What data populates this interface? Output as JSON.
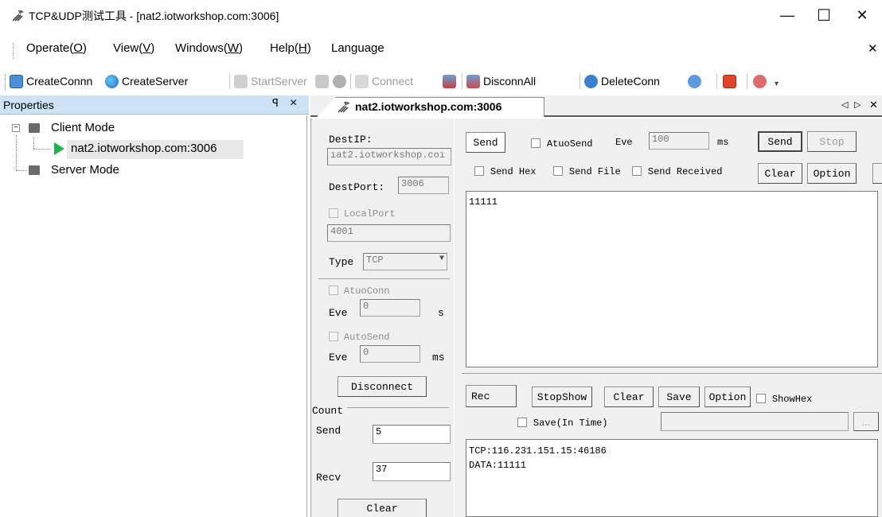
{
  "window": {
    "title": "TCP&UDP测试工具 - [nat2.iotworkshop.com:3006]",
    "minimize": "—",
    "maximize": "☐",
    "close": "✕",
    "menu_close": "✕"
  },
  "menu": {
    "items": [
      {
        "pre": "Operate(",
        "key": "O",
        "post": ")"
      },
      {
        "pre": "View(",
        "key": "V",
        "post": ")"
      },
      {
        "pre": "Windows(",
        "key": "W",
        "post": ")"
      },
      {
        "pre": "Help(",
        "key": "H",
        "post": ")"
      },
      {
        "pre": "Language",
        "key": "",
        "post": ""
      }
    ]
  },
  "toolbar": {
    "create_conn": "CreateConnn",
    "create_server": "CreateServer",
    "start_server": "StartServer",
    "connect": "Connect",
    "disconn_all": "DisconnAll",
    "delete_conn": "DeleteConn",
    "overflow": "▾"
  },
  "properties": {
    "title": "Properties",
    "pin": "ꟼ",
    "close": "×",
    "tree": {
      "client_mode": "Client Mode",
      "connection": "nat2.iotworkshop.com:3006",
      "server_mode": "Server Mode",
      "collapse": "−"
    }
  },
  "document": {
    "tab_label": "nat2.iotworkshop.com:3006",
    "nav_left": "◁",
    "nav_right": "▷",
    "close": "✕"
  },
  "settings": {
    "dest_ip_label": "DestIP:",
    "dest_ip_value": "ıat2.iotworkshop.coı",
    "dest_port_label": "DestPort:",
    "dest_port_value": "3006",
    "local_port_label": "LocalPort",
    "local_port_value": "4001",
    "type_label": "Type",
    "type_value": "TCP",
    "auto_conn_label": "AtuoConn",
    "eve_label_1": "Eve",
    "eve_value_1": "0",
    "eve_unit_1": "s",
    "auto_send_label": "AutoSend",
    "eve_label_2": "Eve",
    "eve_value_2": "0",
    "eve_unit_2": "ms",
    "disconnect_button": "Disconnect",
    "count_label": "Count",
    "send_label": "Send",
    "send_count": "5",
    "recv_label": "Recv",
    "recv_count": "37",
    "clear_button": "Clear"
  },
  "send_panel": {
    "send_tab": "Send",
    "auto_send_label": "AtuoSend",
    "eve_label": "Eve",
    "eve_value": "100",
    "ms_label": "ms",
    "send_button": "Send",
    "stop_button": "Stop",
    "send_hex_label": "Send Hex",
    "send_file_label": "Send File",
    "send_received_label": "Send Received",
    "clear_button": "Clear",
    "option_button": "Option",
    "content": "11111"
  },
  "recv_panel": {
    "rec_tab": "Rec",
    "stop_show_button": "StopShow",
    "clear_button": "Clear",
    "save_button": "Save",
    "option_button": "Option",
    "show_hex_label": "ShowHex",
    "save_in_time_label": "Save(In Time)",
    "browse_button": "...",
    "line1": "TCP:116.231.151.15:46186",
    "line2": "DATA:11111"
  }
}
